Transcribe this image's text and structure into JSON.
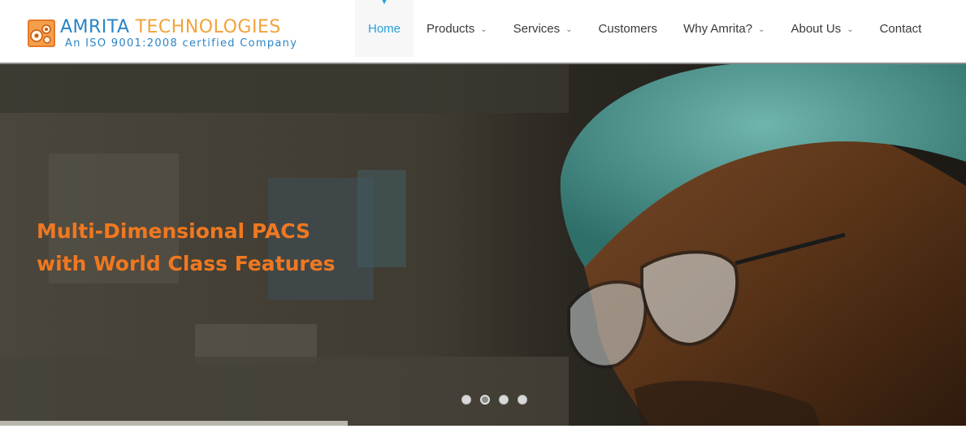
{
  "brand": {
    "name_part1": "AMRITA",
    "name_part2": "TECHNOLOGIES",
    "tagline": "An ISO 9001:2008 certified Company",
    "logo_icon": "molecule-logo-icon"
  },
  "nav": {
    "items": [
      {
        "label": "Home",
        "active": true,
        "dropdown": false
      },
      {
        "label": "Products",
        "active": false,
        "dropdown": true
      },
      {
        "label": "Services",
        "active": false,
        "dropdown": true
      },
      {
        "label": "Customers",
        "active": false,
        "dropdown": false
      },
      {
        "label": "Why Amrita?",
        "active": false,
        "dropdown": true
      },
      {
        "label": "About Us",
        "active": false,
        "dropdown": true
      },
      {
        "label": "Contact",
        "active": false,
        "dropdown": false
      }
    ],
    "dropdown_icon": "chevron-down-icon"
  },
  "hero": {
    "headline_line1": "Multi-Dimensional PACS",
    "headline_line2": "with World Class Features",
    "slide_count": 4,
    "active_slide": 2,
    "slide_progress": 0.36
  },
  "colors": {
    "brand_blue": "#2a84c6",
    "brand_orange": "#f1a33a",
    "nav_active": "#26a0d6",
    "headline_orange": "#f07820"
  }
}
